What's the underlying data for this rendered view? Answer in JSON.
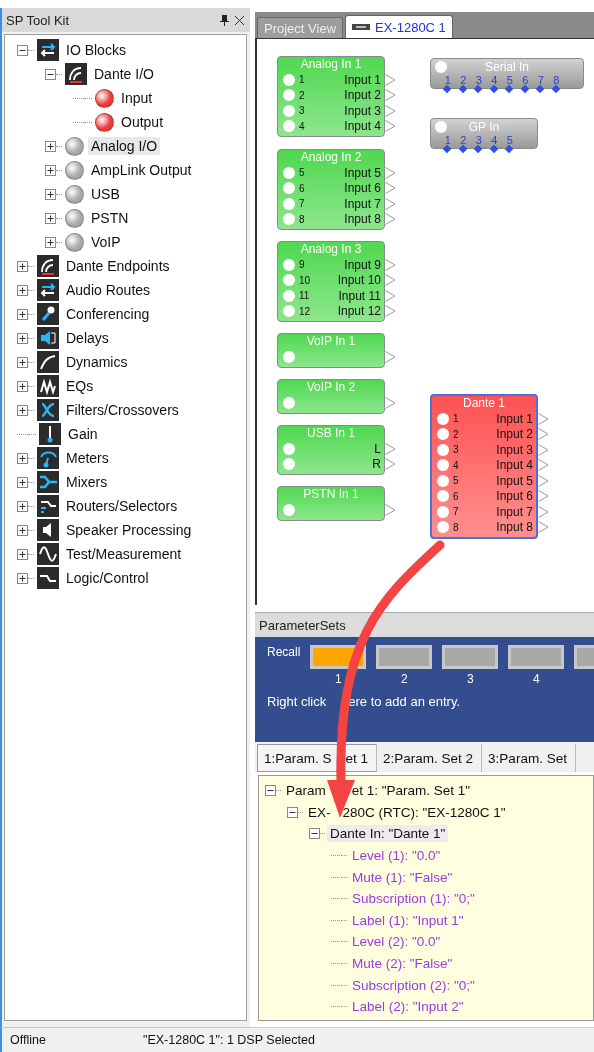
{
  "toolkit": {
    "title": "SP Tool Kit",
    "tree": [
      {
        "label": "IO Blocks",
        "kind": "category",
        "expandable": true,
        "expanded": true,
        "selected": false,
        "children": [
          {
            "label": "Dante I/O",
            "kind": "category",
            "expandable": true,
            "expanded": true,
            "selected": false,
            "children": [
              {
                "label": "Input",
                "kind": "ball",
                "expandable": false,
                "selected": false,
                "color": "#ee3b3b"
              },
              {
                "label": "Output",
                "kind": "ball",
                "expandable": false,
                "selected": false,
                "color": "#ee3b3b"
              }
            ]
          },
          {
            "label": "Analog I/O",
            "kind": "ball",
            "expandable": true,
            "expanded": false,
            "selected": true,
            "color": "#a8a8a8"
          },
          {
            "label": "AmpLink Output",
            "kind": "ball",
            "expandable": true,
            "expanded": false,
            "selected": false,
            "color": "#a8a8a8"
          },
          {
            "label": "USB",
            "kind": "ball",
            "expandable": true,
            "expanded": false,
            "selected": false,
            "color": "#a8a8a8"
          },
          {
            "label": "PSTN",
            "kind": "ball",
            "expandable": true,
            "expanded": false,
            "selected": false,
            "color": "#a8a8a8"
          },
          {
            "label": "VoIP",
            "kind": "ball",
            "expandable": true,
            "expanded": false,
            "selected": false,
            "color": "#a8a8a8"
          }
        ]
      },
      {
        "label": "Dante Endpoints",
        "kind": "category",
        "expandable": true,
        "expanded": false,
        "selected": false
      },
      {
        "label": "Audio Routes",
        "kind": "category",
        "expandable": true,
        "expanded": false,
        "selected": false
      },
      {
        "label": "Conferencing",
        "kind": "category",
        "expandable": true,
        "expanded": false,
        "selected": false
      },
      {
        "label": "Delays",
        "kind": "category",
        "expandable": true,
        "expanded": false,
        "selected": false
      },
      {
        "label": "Dynamics",
        "kind": "category",
        "expandable": true,
        "expanded": false,
        "selected": false
      },
      {
        "label": "EQs",
        "kind": "category",
        "expandable": true,
        "expanded": false,
        "selected": false
      },
      {
        "label": "Filters/Crossovers",
        "kind": "category",
        "expandable": true,
        "expanded": false,
        "selected": false
      },
      {
        "label": "Gain",
        "kind": "category",
        "expandable": false,
        "selected": false
      },
      {
        "label": "Meters",
        "kind": "category",
        "expandable": true,
        "expanded": false,
        "selected": false
      },
      {
        "label": "Mixers",
        "kind": "category",
        "expandable": true,
        "expanded": false,
        "selected": false
      },
      {
        "label": "Routers/Selectors",
        "kind": "category",
        "expandable": true,
        "expanded": false,
        "selected": false
      },
      {
        "label": "Speaker Processing",
        "kind": "category",
        "expandable": true,
        "expanded": false,
        "selected": false
      },
      {
        "label": "Test/Measurement",
        "kind": "category",
        "expandable": true,
        "expanded": false,
        "selected": false
      },
      {
        "label": "Logic/Control",
        "kind": "category",
        "expandable": true,
        "expanded": false,
        "selected": false
      }
    ]
  },
  "view_tabs": [
    {
      "label": "Project View",
      "selected": false
    },
    {
      "label": "EX-1280C 1",
      "selected": true
    }
  ],
  "blocks": [
    {
      "title": "Analog In 1",
      "kind": "audio",
      "color": "#4fd84f",
      "selected": false,
      "ports": [
        {
          "kind": "numbered",
          "number": "1",
          "label": "Input 1"
        },
        {
          "kind": "numbered",
          "number": "2",
          "label": "Input 2"
        },
        {
          "kind": "numbered",
          "number": "3",
          "label": "Input 3"
        },
        {
          "kind": "numbered",
          "number": "4",
          "label": "Input 4"
        }
      ]
    },
    {
      "title": "Analog In 2",
      "kind": "audio",
      "color": "#4fd84f",
      "selected": false,
      "ports": [
        {
          "kind": "numbered",
          "number": "5",
          "label": "Input 5"
        },
        {
          "kind": "numbered",
          "number": "6",
          "label": "Input 6"
        },
        {
          "kind": "numbered",
          "number": "7",
          "label": "Input 7"
        },
        {
          "kind": "numbered",
          "number": "8",
          "label": "Input 8"
        }
      ]
    },
    {
      "title": "Analog In 3",
      "kind": "audio",
      "color": "#4fd84f",
      "selected": false,
      "ports": [
        {
          "kind": "numbered",
          "number": "9",
          "label": "Input 9"
        },
        {
          "kind": "numbered",
          "number": "10",
          "label": "Input 10"
        },
        {
          "kind": "numbered",
          "number": "11",
          "label": "Input 11"
        },
        {
          "kind": "numbered",
          "number": "12",
          "label": "Input 12"
        }
      ]
    },
    {
      "title": "VoIP In 1",
      "kind": "audio",
      "color": "#4fd84f",
      "selected": false,
      "ports": [
        {
          "kind": "unlabeled"
        }
      ]
    },
    {
      "title": "VoIP In 2",
      "kind": "audio",
      "color": "#4fd84f",
      "selected": false,
      "ports": [
        {
          "kind": "unlabeled"
        }
      ]
    },
    {
      "title": "USB In 1",
      "kind": "audio",
      "color": "#4fd84f",
      "selected": false,
      "ports": [
        {
          "kind": "channel",
          "label": "L"
        },
        {
          "kind": "channel",
          "label": "R"
        }
      ]
    },
    {
      "title": "PSTN In 1",
      "kind": "audio",
      "color": "#4fd84f",
      "selected": false,
      "ports": [
        {
          "kind": "unlabeled"
        }
      ]
    },
    {
      "title": "Serial In",
      "kind": "control",
      "selected": false,
      "pins": [
        "1",
        "2",
        "3",
        "4",
        "5",
        "6",
        "7",
        "8"
      ]
    },
    {
      "title": "GP In",
      "kind": "control",
      "selected": false,
      "pins": [
        "1",
        "2",
        "3",
        "4",
        "5"
      ]
    },
    {
      "title": "Dante 1",
      "kind": "audio",
      "color": "#ff5252",
      "selected": true,
      "ports": [
        {
          "kind": "numbered",
          "number": "1",
          "label": "Input 1"
        },
        {
          "kind": "numbered",
          "number": "2",
          "label": "Input 2"
        },
        {
          "kind": "numbered",
          "number": "3",
          "label": "Input 3"
        },
        {
          "kind": "numbered",
          "number": "4",
          "label": "Input 4"
        },
        {
          "kind": "numbered",
          "number": "5",
          "label": "Input 5"
        },
        {
          "kind": "numbered",
          "number": "6",
          "label": "Input 6"
        },
        {
          "kind": "numbered",
          "number": "7",
          "label": "Input 7"
        },
        {
          "kind": "numbered",
          "number": "8",
          "label": "Input 8"
        }
      ]
    }
  ],
  "parameter_sets": {
    "title": "ParameterSets",
    "recall_label": "Recall",
    "slots": [
      {
        "label": "1",
        "selected": true
      },
      {
        "label": "2",
        "selected": false
      },
      {
        "label": "3",
        "selected": false
      },
      {
        "label": "4",
        "selected": false
      },
      {
        "selected": false
      }
    ],
    "hint": [
      "Right click",
      "ere to add an entry."
    ],
    "tabs": [
      {
        "label": [
          "1:Param. S",
          "et 1"
        ],
        "selected": true
      },
      {
        "label": [
          "2:Param. Set 2"
        ],
        "selected": false
      },
      {
        "label": [
          "3:Param. Set"
        ],
        "selected": false
      }
    ],
    "tree": [
      {
        "label": [
          "Param",
          "et 1: \"Param. Set 1\""
        ],
        "kind": "node",
        "expanded": true,
        "selected": false,
        "children": [
          {
            "label": [
              "EX-",
              "280C (RTC): \"EX-1280C 1\""
            ],
            "kind": "node",
            "expanded": true,
            "selected": false,
            "children": [
              {
                "label": [
                  "Dante In: \"Dante 1\""
                ],
                "kind": "node",
                "expanded": true,
                "selected": true,
                "children": [
                  {
                    "label": [
                      "Level (1): \"0.0\""
                    ],
                    "kind": "value",
                    "selected": false
                  },
                  {
                    "label": [
                      "Mute (1): \"False\""
                    ],
                    "kind": "value",
                    "selected": false
                  },
                  {
                    "label": [
                      "Subscription (1): \"0;\""
                    ],
                    "kind": "value",
                    "selected": false
                  },
                  {
                    "label": [
                      "Label (1): \"Input 1\""
                    ],
                    "kind": "value",
                    "selected": false
                  },
                  {
                    "label": [
                      "Level (2): \"0.0\""
                    ],
                    "kind": "value",
                    "selected": false
                  },
                  {
                    "label": [
                      "Mute (2): \"False\""
                    ],
                    "kind": "value",
                    "selected": false
                  },
                  {
                    "label": [
                      "Subscription (2): \"0;\""
                    ],
                    "kind": "value",
                    "selected": false
                  },
                  {
                    "label": [
                      "Label (2): \"Input 2\""
                    ],
                    "kind": "value",
                    "selected": false
                  }
                ]
              }
            ]
          }
        ]
      }
    ]
  },
  "status_bar": {
    "state": "Offline",
    "message": "\"EX-1280C 1\": 1 DSP Selected"
  }
}
